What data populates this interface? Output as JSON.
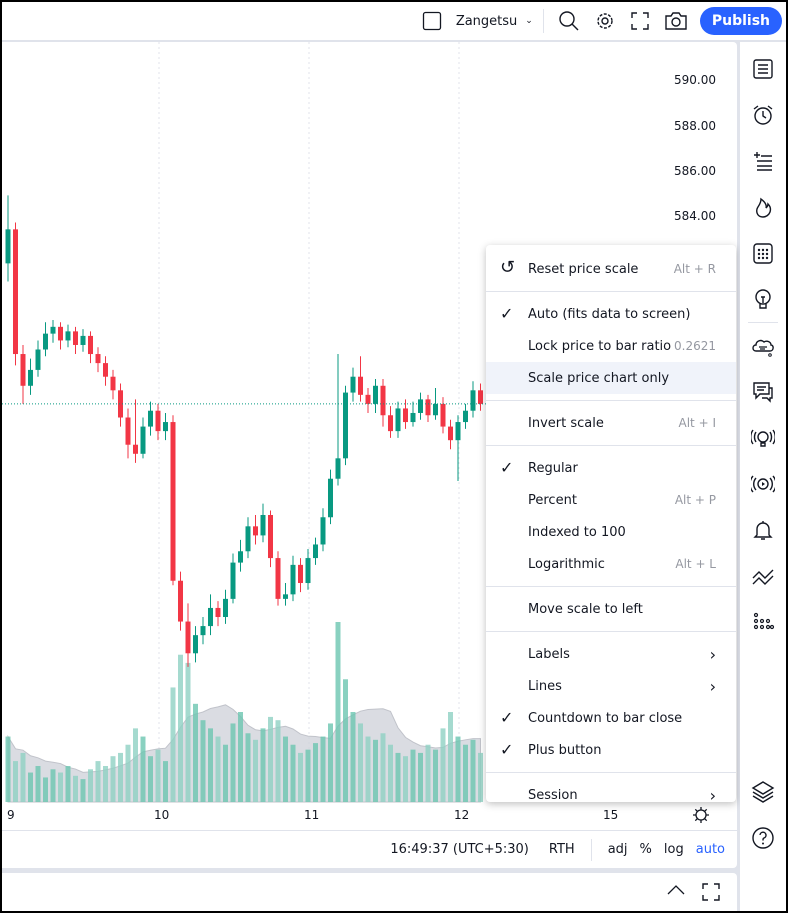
{
  "topbar": {
    "layout_name": "Zangetsu",
    "publish_label": "Publish",
    "icons": [
      "square-icon",
      "chevron-down-icon",
      "search-icon",
      "gear-icon",
      "fullscreen-icon",
      "camera-icon"
    ]
  },
  "price_scale": {
    "labels": [
      "590.00",
      "588.00",
      "586.00",
      "584.00"
    ]
  },
  "time_scale": {
    "labels": [
      "9",
      "10",
      "11",
      "12",
      "15"
    ]
  },
  "colors": {
    "up": "#089981",
    "down": "#f23645",
    "accent": "#2962ff",
    "volume_up": "#8fd1c3",
    "volume_down": "#8fd1c3"
  },
  "candles": [
    [
      582.0,
      585.0,
      581.2,
      583.5
    ],
    [
      583.5,
      583.8,
      577.5,
      578.0
    ],
    [
      578.0,
      578.4,
      575.8,
      576.6
    ],
    [
      576.6,
      577.8,
      576.2,
      577.3
    ],
    [
      577.3,
      578.6,
      577.0,
      578.2
    ],
    [
      578.2,
      579.4,
      577.9,
      578.9
    ],
    [
      578.9,
      579.5,
      578.5,
      579.2
    ],
    [
      579.2,
      579.4,
      578.2,
      578.6
    ],
    [
      578.6,
      579.3,
      578.3,
      579.0
    ],
    [
      579.0,
      579.2,
      578.0,
      578.4
    ],
    [
      578.4,
      579.1,
      578.1,
      578.8
    ],
    [
      578.8,
      579.0,
      577.6,
      578.0
    ],
    [
      578.0,
      578.3,
      577.2,
      577.6
    ],
    [
      577.6,
      577.9,
      576.6,
      577.0
    ],
    [
      577.0,
      577.3,
      576.0,
      576.4
    ],
    [
      576.4,
      576.7,
      574.8,
      575.2
    ],
    [
      575.2,
      575.6,
      573.4,
      574.0
    ],
    [
      574.0,
      576.0,
      573.2,
      573.6
    ],
    [
      573.6,
      575.2,
      573.4,
      574.8
    ],
    [
      574.8,
      575.9,
      574.4,
      575.5
    ],
    [
      575.5,
      575.8,
      574.2,
      574.6
    ],
    [
      574.6,
      575.4,
      574.2,
      575.0
    ],
    [
      575.0,
      575.3,
      567.8,
      568.0
    ],
    [
      568.0,
      568.4,
      565.8,
      566.2
    ],
    [
      566.2,
      567.0,
      564.2,
      564.8
    ],
    [
      564.8,
      566.0,
      564.4,
      565.6
    ],
    [
      565.6,
      566.4,
      565.2,
      566.0
    ],
    [
      566.0,
      567.4,
      565.6,
      566.8
    ],
    [
      566.8,
      567.1,
      566.0,
      566.4
    ],
    [
      566.4,
      567.6,
      566.1,
      567.2
    ],
    [
      567.2,
      569.2,
      567.0,
      568.8
    ],
    [
      568.8,
      569.8,
      568.4,
      569.3
    ],
    [
      569.3,
      570.8,
      569.0,
      570.4
    ],
    [
      570.4,
      570.9,
      569.6,
      570.0
    ],
    [
      570.0,
      571.4,
      569.7,
      570.9
    ],
    [
      570.9,
      571.1,
      568.6,
      569.0
    ],
    [
      569.0,
      569.3,
      566.9,
      567.2
    ],
    [
      567.2,
      567.9,
      566.9,
      567.4
    ],
    [
      567.4,
      569.1,
      567.1,
      568.7
    ],
    [
      568.7,
      569.0,
      567.5,
      567.9
    ],
    [
      567.9,
      569.4,
      567.6,
      569.0
    ],
    [
      569.0,
      569.9,
      568.7,
      569.6
    ],
    [
      569.6,
      571.2,
      569.3,
      570.8
    ],
    [
      570.8,
      572.9,
      570.5,
      572.5
    ],
    [
      572.5,
      578.0,
      572.2,
      573.4
    ],
    [
      573.4,
      576.6,
      573.1,
      576.3
    ],
    [
      576.3,
      577.4,
      575.9,
      577.0
    ],
    [
      577.0,
      577.9,
      575.9,
      576.2
    ],
    [
      576.2,
      576.5,
      575.4,
      575.8
    ],
    [
      575.8,
      576.9,
      575.4,
      576.6
    ],
    [
      576.6,
      576.9,
      574.8,
      575.3
    ],
    [
      575.3,
      575.7,
      574.3,
      574.6
    ],
    [
      574.6,
      575.9,
      574.3,
      575.6
    ],
    [
      575.6,
      576.0,
      574.7,
      575.0
    ],
    [
      575.0,
      575.9,
      574.8,
      575.4
    ],
    [
      575.4,
      576.3,
      575.1,
      576.0
    ],
    [
      576.0,
      576.2,
      575.0,
      575.3
    ],
    [
      575.3,
      576.5,
      575.1,
      575.8
    ],
    [
      575.8,
      576.1,
      574.5,
      574.8
    ],
    [
      574.8,
      575.1,
      573.8,
      574.2
    ],
    [
      574.2,
      575.3,
      572.4,
      575.0
    ],
    [
      575.0,
      575.8,
      574.7,
      575.5
    ],
    [
      575.5,
      576.8,
      575.2,
      576.4
    ],
    [
      576.4,
      576.7,
      575.5,
      575.8
    ]
  ],
  "volumes": [
    40,
    25,
    30,
    18,
    22,
    15,
    20,
    18,
    22,
    16,
    14,
    20,
    25,
    22,
    28,
    30,
    35,
    45,
    40,
    28,
    32,
    25,
    70,
    90,
    85,
    60,
    50,
    45,
    40,
    35,
    48,
    55,
    42,
    38,
    45,
    52,
    50,
    40,
    35,
    30,
    32,
    36,
    40,
    48,
    110,
    75,
    55,
    48,
    40,
    38,
    42,
    35,
    30,
    28,
    32,
    30,
    35,
    32,
    45,
    55,
    40,
    35,
    38,
    30
  ],
  "menu": {
    "items": [
      {
        "label": "Reset price scale",
        "shortcut": "Alt + R"
      },
      {
        "label": "Auto (fits data to screen)",
        "checked": true
      },
      {
        "label": "Lock price to bar ratio",
        "shortcut": "0.2621"
      },
      {
        "label": "Scale price chart only",
        "highlighted": true
      },
      {
        "label": "Invert scale",
        "shortcut": "Alt + I"
      },
      {
        "label": "Regular",
        "checked": true
      },
      {
        "label": "Percent",
        "shortcut": "Alt + P"
      },
      {
        "label": "Indexed to 100"
      },
      {
        "label": "Logarithmic",
        "shortcut": "Alt + L"
      },
      {
        "label": "Move scale to left"
      },
      {
        "label": "Labels",
        "submenu": true
      },
      {
        "label": "Lines",
        "submenu": true
      },
      {
        "label": "Countdown to bar close",
        "checked": true
      },
      {
        "label": "Plus button",
        "checked": true
      },
      {
        "label": "Session",
        "submenu": true
      }
    ]
  },
  "statusbar": {
    "time": "16:49:37 (UTC+5:30)",
    "session": "RTH",
    "adj": "adj",
    "percent": "%",
    "log": "log",
    "auto": "auto"
  },
  "sidebar": {
    "icons": [
      "watchlist-icon",
      "alarm-clock-icon",
      "add-list-icon",
      "hotlist-fire-icon",
      "calendar-icon",
      "idea-lightbulb-icon",
      "chat-cloud-icon",
      "messages-icon",
      "streams-icon",
      "broadcast-icon",
      "notification-bell-icon",
      "trend-lines-icon",
      "dot-grid-icon",
      "layers-icon",
      "help-icon"
    ]
  }
}
